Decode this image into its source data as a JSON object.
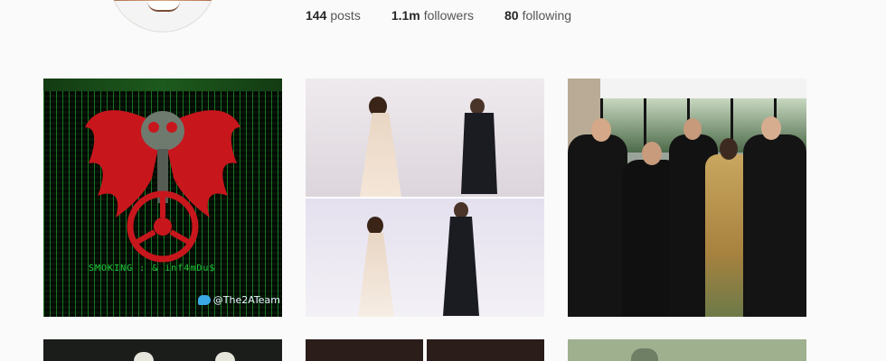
{
  "profile": {
    "stats": [
      {
        "num": "144",
        "label": "posts"
      },
      {
        "num": "1.1m",
        "label": "followers"
      },
      {
        "num": "80",
        "label": "following"
      }
    ]
  },
  "posts": {
    "hacked": {
      "overlay_text": "SMOKING : & inf4mDu$",
      "twitter_tag": "@The2ATeam"
    }
  },
  "colors": {
    "background": "#fafafa",
    "matrix_green": "#1fd03a",
    "eagle_red": "#c8161d",
    "twitter_blue": "#3ba9e6"
  }
}
